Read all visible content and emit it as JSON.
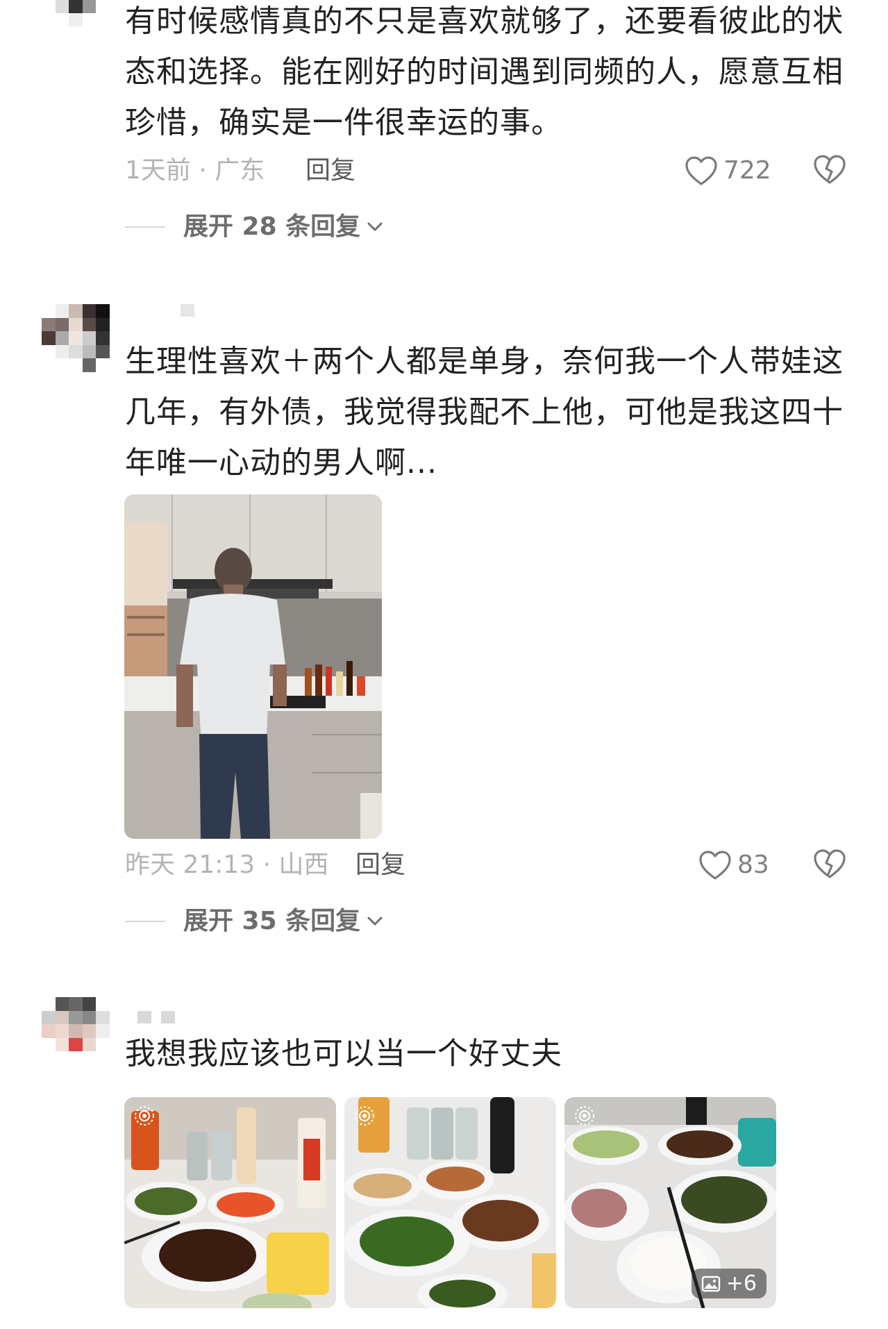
{
  "comments": [
    {
      "text": "有时候感情真的不只是喜欢就够了，还要看彼此的状态和选择。能在刚好的时间遇到同频的人，愿意互相珍惜，确实是一件很幸运的事。",
      "time_location": "1天前 · 广东",
      "reply_label": "回复",
      "likes": "722",
      "expand_label": "展开 28 条回复"
    },
    {
      "text": "生理性喜欢＋两个人都是单身，奈何我一个人带娃这几年，有外债，我觉得我配不上他，可他是我这四十年唯一心动的男人啊...",
      "time_location": "昨天 21:13 · 山西",
      "reply_label": "回复",
      "likes": "83",
      "expand_label": "展开 35 条回复"
    },
    {
      "text": "我想我应该也可以当一个好丈夫",
      "more_images_label": "+6"
    }
  ],
  "colors": {
    "text": "#222222",
    "meta_gray": "#b3b3b3",
    "reply_gray": "#5b5b5b",
    "expand_gray": "#6d6d6d"
  },
  "icons": [
    "heart-outline-icon",
    "broken-heart-icon",
    "chevron-down-icon",
    "image-icon",
    "live-photo-icon"
  ]
}
